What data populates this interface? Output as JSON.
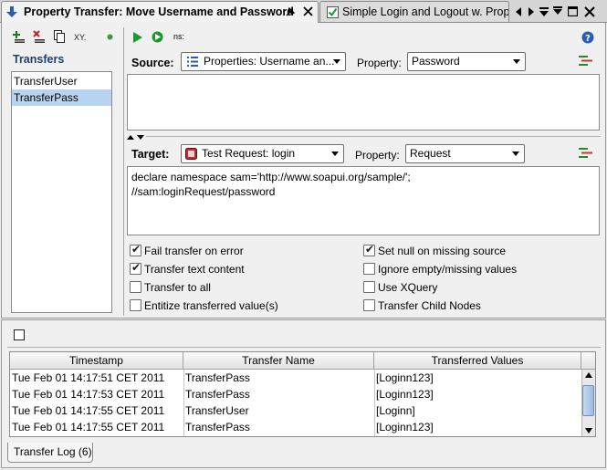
{
  "tabs": [
    {
      "title": "Property Transfer: Move Username and Password",
      "active": true
    },
    {
      "title": "Simple Login and Logout w. Properties",
      "active": false
    }
  ],
  "left_toolbar": {
    "add_label": "+",
    "remove_label": "x",
    "xy_label": "XY."
  },
  "right_toolbar": {
    "ns_label": "ns:"
  },
  "transfers": {
    "heading": "Transfers",
    "items": [
      "TransferUser",
      "TransferPass"
    ],
    "selected": "TransferPass"
  },
  "source": {
    "label": "Source:",
    "combo_value": "Properties: Username an...",
    "property_label": "Property:",
    "property_value": "Password",
    "text": ""
  },
  "target": {
    "label": "Target:",
    "combo_value": "Test Request: login",
    "property_label": "Property:",
    "property_value": "Request",
    "text_line1": "declare namespace sam='http://www.soapui.org/sample/';",
    "text_line2": "//sam:loginRequest/password"
  },
  "options": {
    "fail_on_error": {
      "label": "Fail transfer on error",
      "checked": true
    },
    "transfer_text": {
      "label": "Transfer text content",
      "checked": true
    },
    "transfer_all": {
      "label": "Transfer to all",
      "checked": false
    },
    "entitize": {
      "label": "Entitize transferred value(s)",
      "checked": false
    },
    "set_null": {
      "label": "Set null on missing source",
      "checked": true
    },
    "ignore_empty": {
      "label": "Ignore empty/missing values",
      "checked": false
    },
    "use_xquery": {
      "label": "Use XQuery",
      "checked": false
    },
    "child_nodes": {
      "label": "Transfer Child Nodes",
      "checked": false
    }
  },
  "log": {
    "columns": [
      "Timestamp",
      "Transfer Name",
      "Transferred Values"
    ],
    "rows": [
      [
        "Tue Feb 01 14:17:51 CET 2011",
        "TransferPass",
        "[Loginn123]"
      ],
      [
        "Tue Feb 01 14:17:53 CET 2011",
        "TransferPass",
        "[Loginn123]"
      ],
      [
        "Tue Feb 01 14:17:55 CET 2011",
        "TransferUser",
        "[Loginn]"
      ],
      [
        "Tue Feb 01 14:17:55 CET 2011",
        "TransferPass",
        "[Loginn123]"
      ]
    ],
    "tab_label": "Transfer Log (6)"
  },
  "colors": {
    "selection": "#b8d4f0",
    "heading_blue": "#1f3f7a",
    "run_green": "#1a9a2a"
  }
}
